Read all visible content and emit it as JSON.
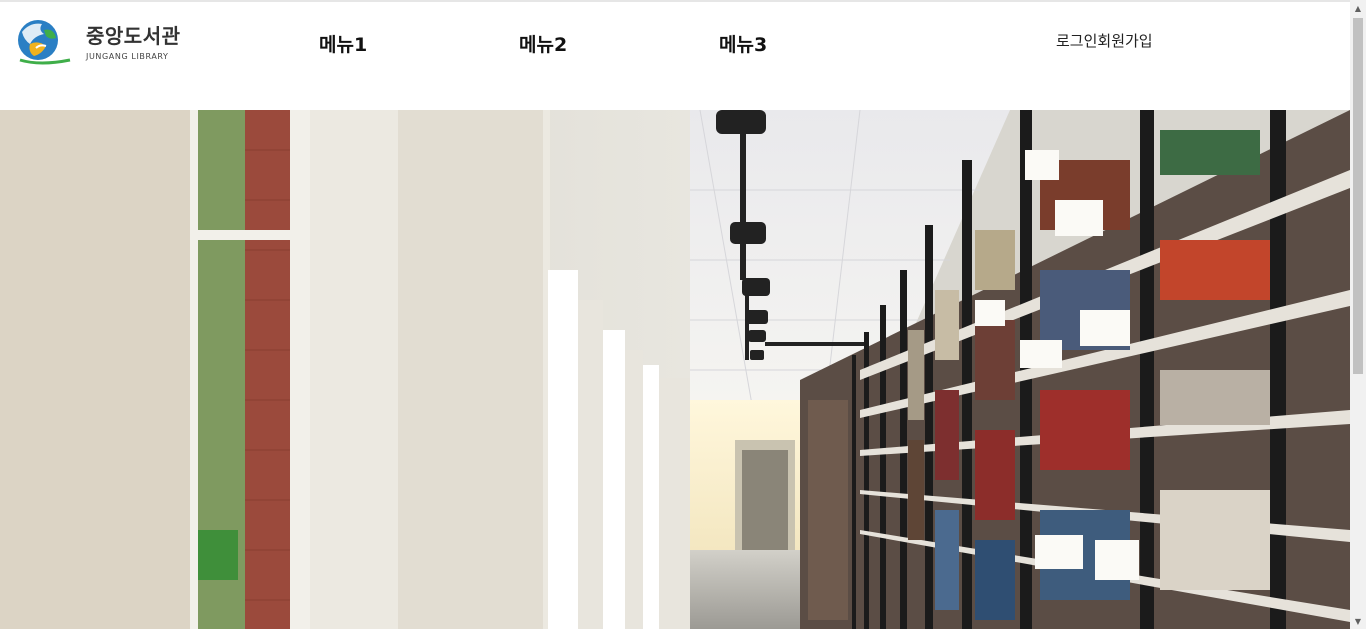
{
  "header": {
    "logo": {
      "korean_name": "중앙도서관",
      "english_name": "JUNGANG LIBRARY",
      "icon": "library-globe-emblem"
    },
    "nav": [
      {
        "label": "메뉴1"
      },
      {
        "label": "메뉴2"
      },
      {
        "label": "메뉴3"
      }
    ],
    "auth": {
      "login_label": "로그인",
      "signup_label": "회원가입"
    }
  },
  "hero": {
    "image": "library-corridor-bookshelves-photo"
  },
  "scrollbar": {
    "up_icon": "scroll-up-arrow-icon",
    "down_icon": "scroll-down-arrow-icon"
  },
  "colors": {
    "header_bg": "#ffffff",
    "text": "#111111",
    "scroll_track": "#f1f1f1",
    "scroll_thumb": "#c1c1c1"
  }
}
